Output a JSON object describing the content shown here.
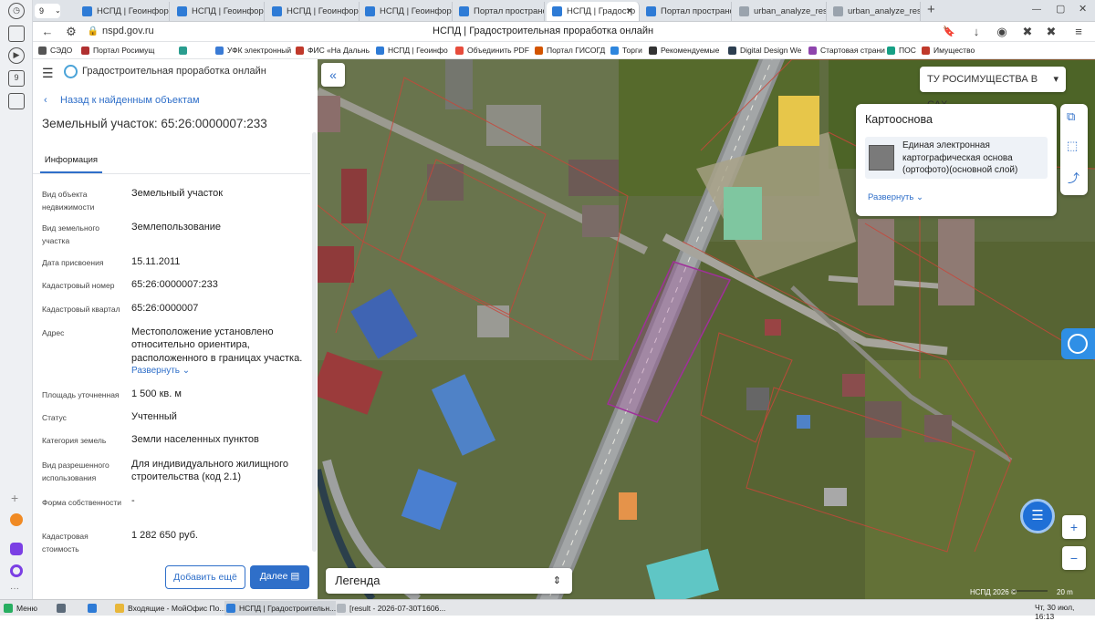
{
  "tabs": [
    {
      "label": "НСПД | Геоинформ"
    },
    {
      "label": "НСПД | Геоинформ"
    },
    {
      "label": "НСПД | Геоинформ"
    },
    {
      "label": "НСПД | Геоинформ"
    },
    {
      "label": "Портал пространст"
    },
    {
      "label": "НСПД | Градостр"
    },
    {
      "label": "Портал пространст"
    },
    {
      "label": "urban_analyze_resul"
    },
    {
      "label": "urban_analyze_resul"
    }
  ],
  "tab_counter": "9",
  "address": {
    "url": "nspd.gov.ru",
    "page_title": "НСПД | Градостроительная проработка онлайн"
  },
  "bookmarks": [
    "СЭДО",
    "Портал Росимущ",
    "УФК электронный",
    "ФИС «На Дальнь",
    "НСПД | Геоинфо",
    "Объединить PDF",
    "Портал ГИСОГД",
    "Торги",
    "Рекомендуемые",
    "Digital Design We",
    "Стартовая страни",
    "ПОС",
    "Имущество"
  ],
  "rail_counter": "9",
  "panel": {
    "app_title": "Градостроительная проработка онлайн",
    "back_link": "Назад к найденным объектам",
    "object_title": "Земельный участок: 65:26:0000007:233",
    "tab_info": "Информация",
    "rows": [
      {
        "label": "Вид объекта недвижимости",
        "value": "Земельный участок"
      },
      {
        "label": "Вид земельного участка",
        "value": "Землепользование"
      },
      {
        "label": "Дата присвоения",
        "value": "15.11.2011"
      },
      {
        "label": "Кадастровый номер",
        "value": "65:26:0000007:233"
      },
      {
        "label": "Кадастровый квартал",
        "value": "65:26:0000007"
      },
      {
        "label": "Адрес",
        "value": "Местоположение установлено относительно ориентира, расположенного в границах участка."
      },
      {
        "label": "Площадь уточненная",
        "value": "1 500 кв. м"
      },
      {
        "label": "Статус",
        "value": "Учтенный"
      },
      {
        "label": "Категория земель",
        "value": "Земли населенных пунктов"
      },
      {
        "label": "Вид разрешенного использования",
        "value": "Для индивидуального жилищного строительства (код 2.1)"
      },
      {
        "label": "Форма собственности",
        "value": "-"
      },
      {
        "label": "Кадастровая стоимость",
        "value": "1 282 650 руб."
      }
    ],
    "expand_link": "Развернуть",
    "add_more_button": "Добавить ещё",
    "next_button": "Далее"
  },
  "map": {
    "region_select": "ТУ РОСИМУЩЕСТВА В САХ...",
    "basemap_title": "Картооснова",
    "basemap_layer": "Единая электронная картографическая основа (ортофото)(основной слой)",
    "basemap_expand": "Развернуть",
    "legend": "Легенда",
    "zoom_in": "+",
    "zoom_out": "−",
    "copyright": "НСПД 2026 ©",
    "scale": "20 m"
  },
  "taskbar": {
    "menu": "Меню",
    "items": [
      "Входящие - МойОфис По...",
      "НСПД | Градостроительн...",
      "[result - 2026-07-30T1606..."
    ],
    "clock": "Чт, 30 июл, 16:13"
  },
  "colors": {
    "accent": "#2f6fc9",
    "parcel": "#a0309a",
    "boundary": "#c8463a"
  }
}
